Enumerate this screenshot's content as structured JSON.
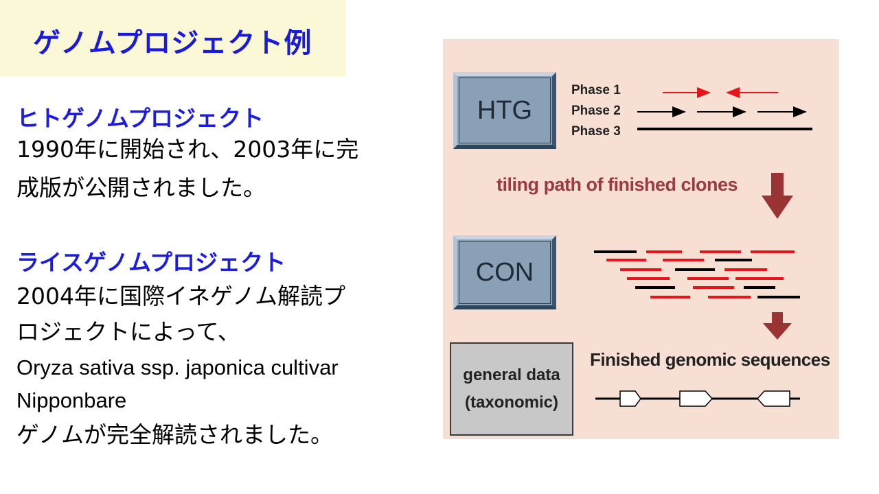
{
  "title": "ゲノムプロジェクト例",
  "sections": [
    {
      "heading": "ヒトゲノムプロジェクト",
      "lines": [
        "1990年に開始され、2003年に完",
        "成版が公開されました。"
      ]
    },
    {
      "heading": "ライスゲノムプロジェクト",
      "lines": [
        "2004年に国際イネゲノム解読プ",
        "ロジェクトによって、"
      ],
      "latin_lines": [
        "Oryza sativa ssp. japonica cultivar",
        "Nipponbare"
      ],
      "closing": "ゲノムが完全解読されました。"
    }
  ],
  "diagram": {
    "htg_label": "HTG",
    "con_label": "CON",
    "general_data_lines": [
      "general data",
      "(taxonomic)"
    ],
    "phases": [
      "Phase 1",
      "Phase 2",
      "Phase 3"
    ],
    "tiling_text": "tiling path of finished clones",
    "finished_text": "Finished genomic sequences",
    "colors": {
      "red": "#e8141c",
      "dark_red_arrow": "#9a3434",
      "black": "#000000",
      "background": "#f7dfd3"
    }
  }
}
